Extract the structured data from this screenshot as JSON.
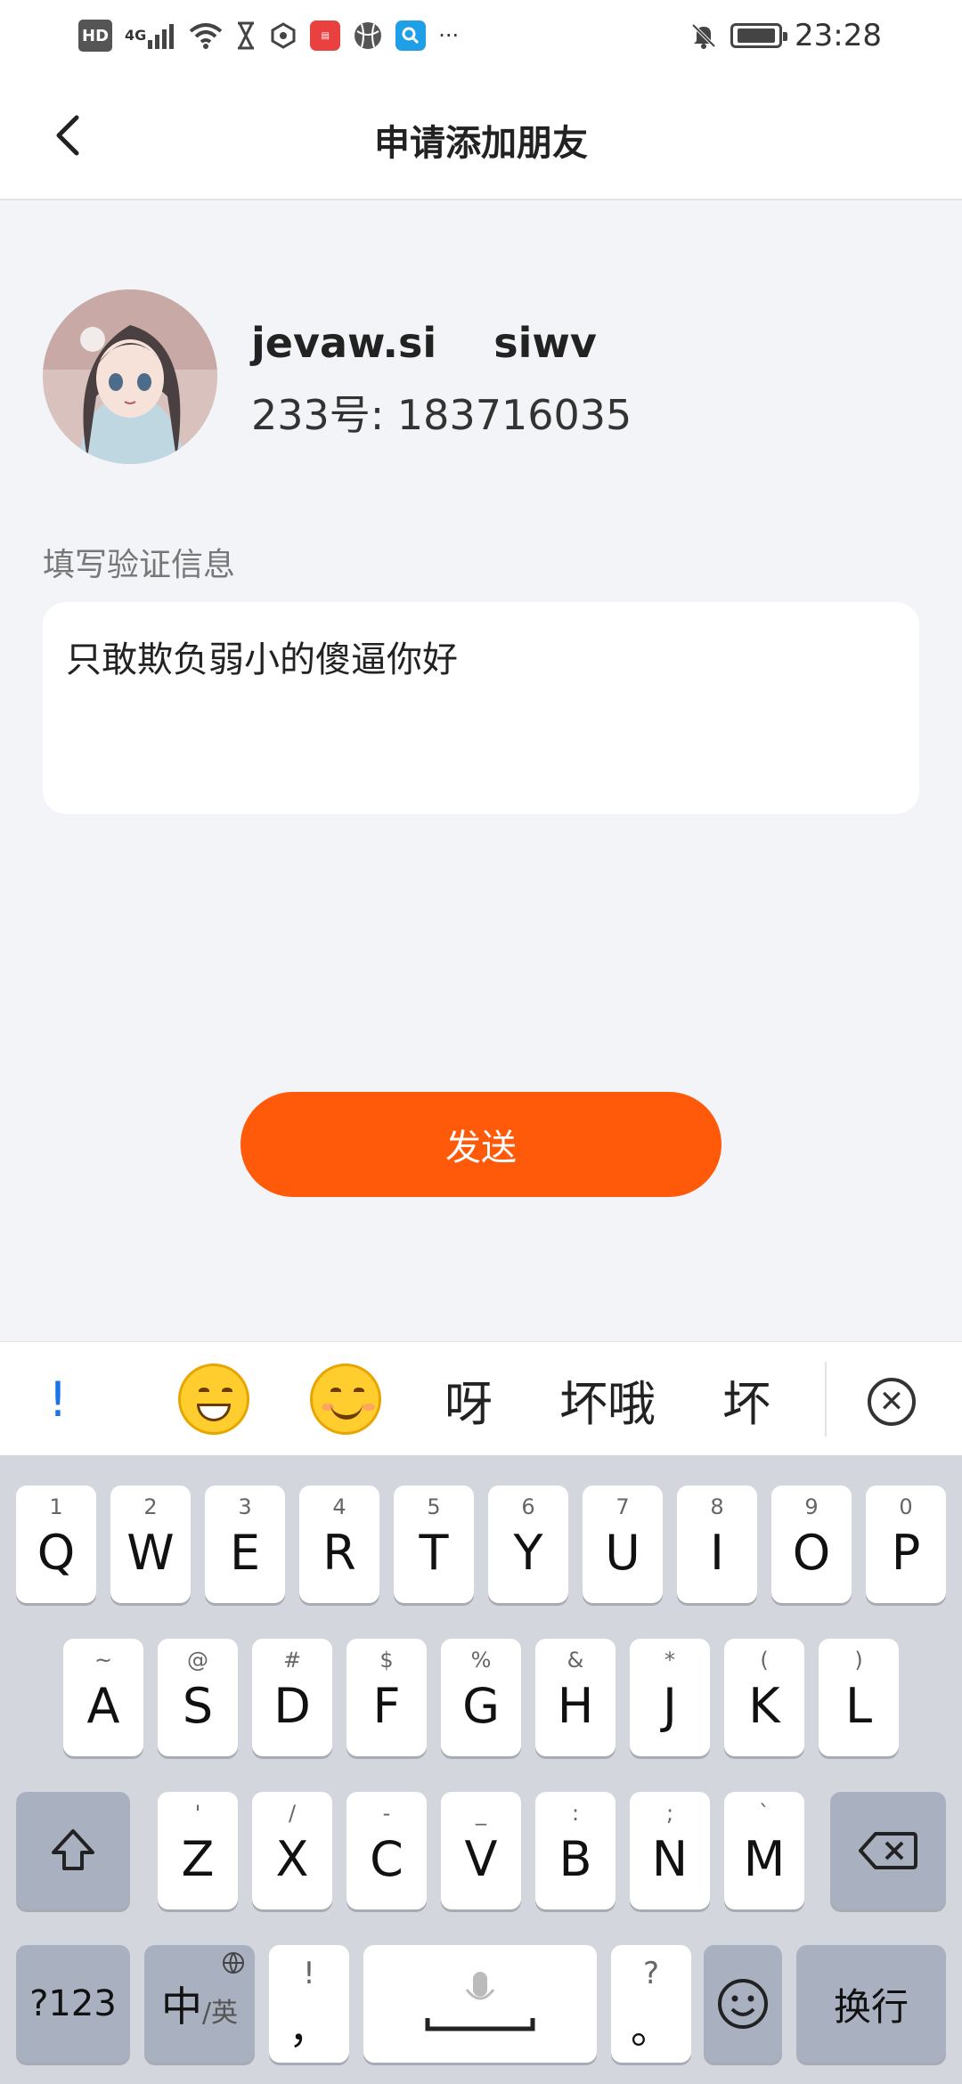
{
  "status_bar": {
    "hd": "HD",
    "net": "4G",
    "time": "23:28",
    "battery_level": 0.9
  },
  "header": {
    "title": "申请添加朋友"
  },
  "profile": {
    "username": "jevaw.si    siwv",
    "id_text": "233号: 183716035"
  },
  "form": {
    "label": "填写验证信息",
    "message": "只敢欺负弱小的傻逼你好"
  },
  "send_button": {
    "label": "发送"
  },
  "candidates": {
    "items": [
      "!",
      "呀",
      "坏哦",
      "坏"
    ]
  },
  "keyboard": {
    "row1": [
      {
        "k": "Q",
        "s": "1"
      },
      {
        "k": "W",
        "s": "2"
      },
      {
        "k": "E",
        "s": "3"
      },
      {
        "k": "R",
        "s": "4"
      },
      {
        "k": "T",
        "s": "5"
      },
      {
        "k": "Y",
        "s": "6"
      },
      {
        "k": "U",
        "s": "7"
      },
      {
        "k": "I",
        "s": "8"
      },
      {
        "k": "O",
        "s": "9"
      },
      {
        "k": "P",
        "s": "0"
      }
    ],
    "row2": [
      {
        "k": "A",
        "s": "~"
      },
      {
        "k": "S",
        "s": "@"
      },
      {
        "k": "D",
        "s": "#"
      },
      {
        "k": "F",
        "s": "$"
      },
      {
        "k": "G",
        "s": "%"
      },
      {
        "k": "H",
        "s": "&"
      },
      {
        "k": "J",
        "s": "*"
      },
      {
        "k": "K",
        "s": "("
      },
      {
        "k": "L",
        "s": ")"
      }
    ],
    "row3": [
      {
        "k": "Z",
        "s": "'"
      },
      {
        "k": "X",
        "s": "/"
      },
      {
        "k": "C",
        "s": "-"
      },
      {
        "k": "V",
        "s": "_"
      },
      {
        "k": "B",
        "s": ":"
      },
      {
        "k": "N",
        "s": ";"
      },
      {
        "k": "M",
        "s": "`"
      }
    ],
    "num_label": "?123",
    "lang_main": "中",
    "lang_sub": "/英",
    "comma_main": "，",
    "comma_sub": "!",
    "period_main": "。",
    "period_sub": "?",
    "enter_label": "换行"
  }
}
